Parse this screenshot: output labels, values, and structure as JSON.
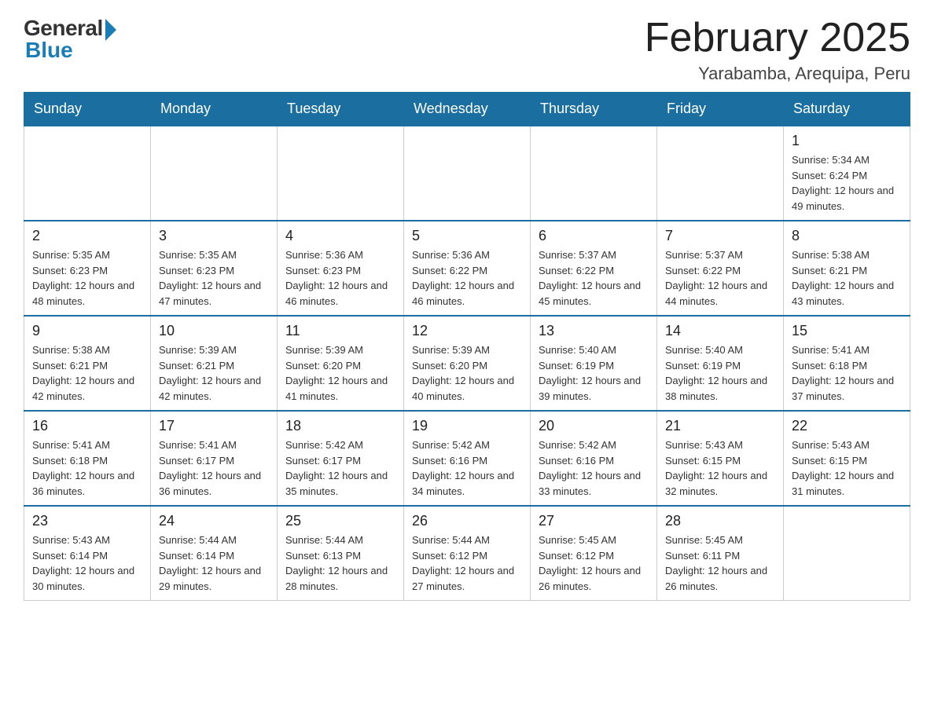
{
  "header": {
    "logo_general": "General",
    "logo_blue": "Blue",
    "month_title": "February 2025",
    "location": "Yarabamba, Arequipa, Peru"
  },
  "days_of_week": [
    "Sunday",
    "Monday",
    "Tuesday",
    "Wednesday",
    "Thursday",
    "Friday",
    "Saturday"
  ],
  "weeks": [
    [
      {
        "day": "",
        "info": ""
      },
      {
        "day": "",
        "info": ""
      },
      {
        "day": "",
        "info": ""
      },
      {
        "day": "",
        "info": ""
      },
      {
        "day": "",
        "info": ""
      },
      {
        "day": "",
        "info": ""
      },
      {
        "day": "1",
        "info": "Sunrise: 5:34 AM\nSunset: 6:24 PM\nDaylight: 12 hours and 49 minutes."
      }
    ],
    [
      {
        "day": "2",
        "info": "Sunrise: 5:35 AM\nSunset: 6:23 PM\nDaylight: 12 hours and 48 minutes."
      },
      {
        "day": "3",
        "info": "Sunrise: 5:35 AM\nSunset: 6:23 PM\nDaylight: 12 hours and 47 minutes."
      },
      {
        "day": "4",
        "info": "Sunrise: 5:36 AM\nSunset: 6:23 PM\nDaylight: 12 hours and 46 minutes."
      },
      {
        "day": "5",
        "info": "Sunrise: 5:36 AM\nSunset: 6:22 PM\nDaylight: 12 hours and 46 minutes."
      },
      {
        "day": "6",
        "info": "Sunrise: 5:37 AM\nSunset: 6:22 PM\nDaylight: 12 hours and 45 minutes."
      },
      {
        "day": "7",
        "info": "Sunrise: 5:37 AM\nSunset: 6:22 PM\nDaylight: 12 hours and 44 minutes."
      },
      {
        "day": "8",
        "info": "Sunrise: 5:38 AM\nSunset: 6:21 PM\nDaylight: 12 hours and 43 minutes."
      }
    ],
    [
      {
        "day": "9",
        "info": "Sunrise: 5:38 AM\nSunset: 6:21 PM\nDaylight: 12 hours and 42 minutes."
      },
      {
        "day": "10",
        "info": "Sunrise: 5:39 AM\nSunset: 6:21 PM\nDaylight: 12 hours and 42 minutes."
      },
      {
        "day": "11",
        "info": "Sunrise: 5:39 AM\nSunset: 6:20 PM\nDaylight: 12 hours and 41 minutes."
      },
      {
        "day": "12",
        "info": "Sunrise: 5:39 AM\nSunset: 6:20 PM\nDaylight: 12 hours and 40 minutes."
      },
      {
        "day": "13",
        "info": "Sunrise: 5:40 AM\nSunset: 6:19 PM\nDaylight: 12 hours and 39 minutes."
      },
      {
        "day": "14",
        "info": "Sunrise: 5:40 AM\nSunset: 6:19 PM\nDaylight: 12 hours and 38 minutes."
      },
      {
        "day": "15",
        "info": "Sunrise: 5:41 AM\nSunset: 6:18 PM\nDaylight: 12 hours and 37 minutes."
      }
    ],
    [
      {
        "day": "16",
        "info": "Sunrise: 5:41 AM\nSunset: 6:18 PM\nDaylight: 12 hours and 36 minutes."
      },
      {
        "day": "17",
        "info": "Sunrise: 5:41 AM\nSunset: 6:17 PM\nDaylight: 12 hours and 36 minutes."
      },
      {
        "day": "18",
        "info": "Sunrise: 5:42 AM\nSunset: 6:17 PM\nDaylight: 12 hours and 35 minutes."
      },
      {
        "day": "19",
        "info": "Sunrise: 5:42 AM\nSunset: 6:16 PM\nDaylight: 12 hours and 34 minutes."
      },
      {
        "day": "20",
        "info": "Sunrise: 5:42 AM\nSunset: 6:16 PM\nDaylight: 12 hours and 33 minutes."
      },
      {
        "day": "21",
        "info": "Sunrise: 5:43 AM\nSunset: 6:15 PM\nDaylight: 12 hours and 32 minutes."
      },
      {
        "day": "22",
        "info": "Sunrise: 5:43 AM\nSunset: 6:15 PM\nDaylight: 12 hours and 31 minutes."
      }
    ],
    [
      {
        "day": "23",
        "info": "Sunrise: 5:43 AM\nSunset: 6:14 PM\nDaylight: 12 hours and 30 minutes."
      },
      {
        "day": "24",
        "info": "Sunrise: 5:44 AM\nSunset: 6:14 PM\nDaylight: 12 hours and 29 minutes."
      },
      {
        "day": "25",
        "info": "Sunrise: 5:44 AM\nSunset: 6:13 PM\nDaylight: 12 hours and 28 minutes."
      },
      {
        "day": "26",
        "info": "Sunrise: 5:44 AM\nSunset: 6:12 PM\nDaylight: 12 hours and 27 minutes."
      },
      {
        "day": "27",
        "info": "Sunrise: 5:45 AM\nSunset: 6:12 PM\nDaylight: 12 hours and 26 minutes."
      },
      {
        "day": "28",
        "info": "Sunrise: 5:45 AM\nSunset: 6:11 PM\nDaylight: 12 hours and 26 minutes."
      },
      {
        "day": "",
        "info": ""
      }
    ]
  ]
}
